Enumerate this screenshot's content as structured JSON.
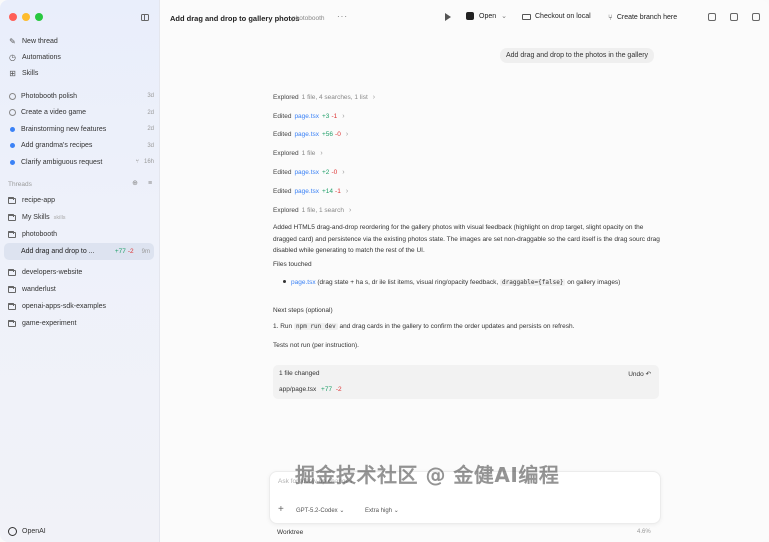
{
  "window": {
    "title": "Add drag and drop to gallery photos",
    "project": "photobooth"
  },
  "sidebar": {
    "nav": [
      {
        "label": "New thread",
        "icon": "compose-icon"
      },
      {
        "label": "Automations",
        "icon": "clock-icon"
      },
      {
        "label": "Skills",
        "icon": "grid-icon"
      }
    ],
    "tasks": [
      {
        "label": "Photobooth polish",
        "age": "3d",
        "status": "ring"
      },
      {
        "label": "Create a video game",
        "age": "2d",
        "status": "ring"
      },
      {
        "label": "Brainstorming new features",
        "age": "2d",
        "status": "dot"
      },
      {
        "label": "Add grandma's recipes",
        "age": "3d",
        "status": "dot"
      },
      {
        "label": "Clarify ambiguous request",
        "age": "16h",
        "status": "dot"
      }
    ],
    "threads_label": "Threads",
    "projects": [
      {
        "label": "recipe-app"
      },
      {
        "label": "My Skills",
        "sub": "skills"
      },
      {
        "label": "photobooth"
      }
    ],
    "active_thread": {
      "label": "Add drag and drop to ...",
      "plus": "+77",
      "minus": "-2",
      "age": "9m"
    },
    "more_projects": [
      {
        "label": "developers-website"
      },
      {
        "label": "wanderlust"
      },
      {
        "label": "openai-apps-sdk-examples"
      },
      {
        "label": "game-experiment"
      }
    ],
    "footer": "OpenAI"
  },
  "toolbar": {
    "open_label": "Open",
    "checkout_label": "Checkout on local",
    "branch_label": "Create branch here"
  },
  "chat": {
    "user_message": "Add drag and drop to the photos in the gallery",
    "log": [
      {
        "key": "Explored",
        "detail": "1 file, 4 searches, 1 list"
      },
      {
        "key": "Edited",
        "file": "page.tsx",
        "plus": "+3",
        "minus": "-1"
      },
      {
        "key": "Edited",
        "file": "page.tsx",
        "plus": "+56",
        "minus": "-0"
      },
      {
        "key": "Explored",
        "detail": "1 file"
      },
      {
        "key": "Edited",
        "file": "page.tsx",
        "plus": "+2",
        "minus": "-0"
      },
      {
        "key": "Edited",
        "file": "page.tsx",
        "plus": "+14",
        "minus": "-1"
      },
      {
        "key": "Explored",
        "detail": "1 file, 1 search"
      }
    ],
    "summary": "Added HTML5 drag-and-drop reordering for the gallery photos with visual feedback (highlight on drop target, slight opacity on the dragged card) and persistence via the existing photos state. The images are set non-draggable so the card itself is the drag sourc     drag    disabled while generating to match the rest of the UI.",
    "files_touched_label": "Files touched",
    "files_touched_file": "page.tsx",
    "files_touched_desc_a": " (drag state + ha       s, dr         ile list items, visual ring/opacity feedback, ",
    "files_touched_code": "draggable={false}",
    "files_touched_desc_b": " on gallery images)",
    "next_steps_label": "Next steps (optional)",
    "step_prefix": "1. Run ",
    "step_code": "npm run dev",
    "step_suffix": " and drag cards in the gallery to confirm the order updates and persists on refresh.",
    "tests_note": "Tests not run (per instruction).",
    "changes": {
      "header": "1 file changed",
      "undo": "Undo",
      "file": "app/page.tsx",
      "plus": "+77",
      "minus": "-2"
    }
  },
  "composer": {
    "placeholder": "Ask for follow-up changes",
    "model": "GPT-5.2-Codex",
    "effort": "Extra high",
    "worktree": "Worktree",
    "usage": "4.6%"
  },
  "watermark": "掘金技术社区 @ 金健AI编程"
}
